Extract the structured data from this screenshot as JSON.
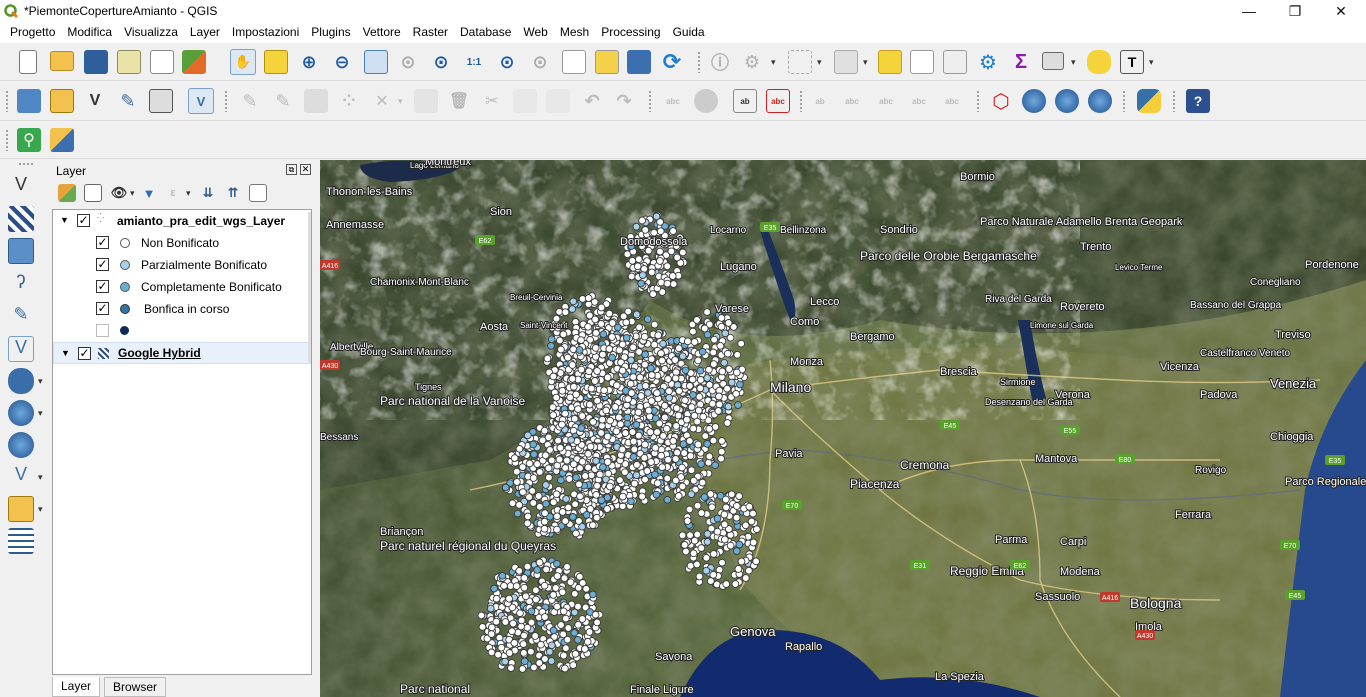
{
  "window": {
    "title": "*PiemonteCopertureAmianto - QGIS",
    "controls": {
      "minimize": "—",
      "maximize": "❐",
      "close": "✕"
    }
  },
  "menu": [
    "Progetto",
    "Modifica",
    "Visualizza",
    "Layer",
    "Impostazioni",
    "Plugins",
    "Vettore",
    "Raster",
    "Database",
    "Web",
    "Mesh",
    "Processing",
    "Guida"
  ],
  "layers_panel": {
    "title": "Layer",
    "tree": [
      {
        "label": "amianto_pra_edit_wgs_Layer",
        "checked": true,
        "expanded": true,
        "bold": true
      },
      {
        "label": "Non Bonificato",
        "checked": true,
        "symbol_color": "#ffffff"
      },
      {
        "label": "Parzialmente Bonificato",
        "checked": true,
        "symbol_color": "#a8d0ea"
      },
      {
        "label": "Completamente Bonificato",
        "checked": true,
        "symbol_color": "#6aaed6"
      },
      {
        "label": "Bonfica in corso",
        "checked": true,
        "symbol_color": "#2f73a8"
      },
      {
        "label": "",
        "checked": false,
        "symbol_color": "#0b2a55"
      },
      {
        "label": "Google Hybrid",
        "checked": true,
        "expanded": true,
        "bold": true,
        "selected": true
      }
    ],
    "tabs": [
      "Layer",
      "Browser"
    ]
  },
  "map": {
    "place_labels": [
      "Lago Lemano",
      "Montreux",
      "Thonon-les-Bains",
      "Annemasse",
      "Sion",
      "Bormio",
      "Parco Naturale Adamello Brenta Geopark",
      "Locarno",
      "Bellinzona",
      "Sondrio",
      "Domodossola",
      "Lugano",
      "Parco delle Orobie Bergamasche",
      "Trento",
      "Levico Terme",
      "Pordenone",
      "Chamonix-Mont-Blanc",
      "Breuil-Cervinia",
      "Varese",
      "Lecco",
      "Riva del Garda",
      "Rovereto",
      "Bassano del Grappa",
      "Conegliano",
      "Aosta",
      "Saint-Vincent",
      "Como",
      "Bergamo",
      "Limone sul Garda",
      "Treviso",
      "Albertville",
      "Bourg-Saint-Maurice",
      "Monza",
      "Brescia",
      "Vicenza",
      "Castelfranco Veneto",
      "Milano",
      "Sirmione",
      "Verona",
      "Venezia",
      "Tignes",
      "Desenzano del Garda",
      "Padova",
      "Parc national de la Vanoise",
      "Chioggia",
      "Bessans",
      "Pavia",
      "Cremona",
      "Mantova",
      "Rovigo",
      "Piacenza",
      "Parco Regionale Veneto del Delta del Po",
      "Ferrara",
      "Briançon",
      "Parma",
      "Carpi",
      "Parc naturel régional du Queyras",
      "Reggio Emilia",
      "Modena",
      "Genova",
      "Sassuolo",
      "Bologna",
      "Imola",
      "Savona",
      "Rapallo",
      "La Spezia",
      "Finale Ligure",
      "Parc national"
    ],
    "road_labels": [
      "E35",
      "E62",
      "A416",
      "A430",
      "E70",
      "E45",
      "E55",
      "E31",
      "E80"
    ]
  }
}
